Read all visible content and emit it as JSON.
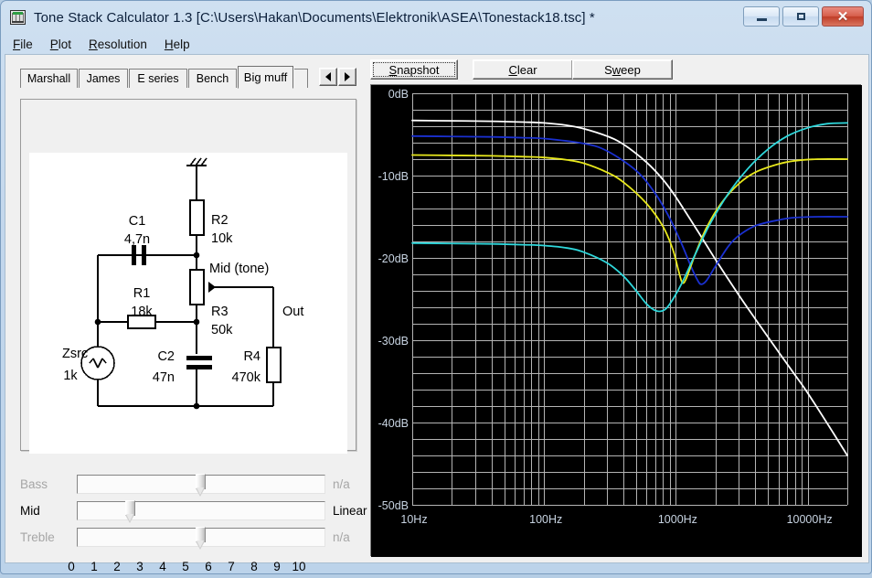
{
  "window": {
    "title": "Tone Stack Calculator 1.3 [C:\\Users\\Hakan\\Documents\\Elektronik\\ASEA\\Tonestack18.tsc] *",
    "icon": "tone-stack-app-icon",
    "buttons": {
      "minimize": "minimize-icon",
      "maximize": "maximize-icon",
      "close": "✕"
    }
  },
  "menubar": {
    "items": [
      {
        "label": "File",
        "accel": "F"
      },
      {
        "label": "Plot",
        "accel": "P"
      },
      {
        "label": "Resolution",
        "accel": "R"
      },
      {
        "label": "Help",
        "accel": "H"
      }
    ]
  },
  "tabs": {
    "items": [
      {
        "label": "Marshall",
        "active": false
      },
      {
        "label": "James",
        "active": false
      },
      {
        "label": "E series",
        "active": false
      },
      {
        "label": "Bench",
        "active": false
      },
      {
        "label": "Big muff",
        "active": true
      }
    ],
    "scroll_prev": "left-arrow-icon",
    "scroll_next": "right-arrow-icon"
  },
  "schematic": {
    "components": [
      {
        "ref": "C1",
        "value": "4,7n"
      },
      {
        "ref": "R2",
        "value": "10k"
      },
      {
        "ref": "R1",
        "value": "18k"
      },
      {
        "ref": "R3",
        "value": "50k"
      },
      {
        "ref": "C2",
        "value": "47n"
      },
      {
        "ref": "R4",
        "value": "470k"
      },
      {
        "ref": "Zsrc",
        "value": "1k"
      }
    ],
    "labels": {
      "mid_tap": "Mid (tone)",
      "output": "Out"
    }
  },
  "sliders": {
    "rows": [
      {
        "name": "bass",
        "label": "Bass",
        "value_text": "n/a",
        "position": 5,
        "disabled": true
      },
      {
        "name": "mid",
        "label": "Mid",
        "value_text": "Linear",
        "position": 1.9,
        "disabled": false
      },
      {
        "name": "treble",
        "label": "Treble",
        "value_text": "n/a",
        "position": 5,
        "disabled": true
      }
    ],
    "scale": [
      "0",
      "1",
      "2",
      "3",
      "4",
      "5",
      "6",
      "7",
      "8",
      "9",
      "10"
    ]
  },
  "toolbar": {
    "snapshot": "Snapshot",
    "clear": "Clear",
    "sweep": "Sweep"
  },
  "chart_data": {
    "type": "line",
    "title": "",
    "xlabel": "",
    "ylabel": "",
    "xscale": "log",
    "xlim": [
      10,
      20000
    ],
    "ylim": [
      -50,
      0
    ],
    "grid": true,
    "legend": false,
    "ytick_labels": [
      "0dB",
      "-10dB",
      "-20dB",
      "-30dB",
      "-40dB",
      "-50dB"
    ],
    "ytick_values": [
      0,
      -10,
      -20,
      -30,
      -40,
      -50
    ],
    "ytick_minor_step": 2,
    "xtick_labels": [
      "10Hz",
      "100Hz",
      "1000Hz",
      "10000Hz"
    ],
    "xtick_values": [
      10,
      100,
      1000,
      10000
    ],
    "background": "#000000",
    "gridcolor": "#b4b4b4",
    "series": [
      {
        "name": "sweep-trace-white",
        "color": "#ffffff",
        "points": [
          [
            10,
            -3.3
          ],
          [
            20,
            -3.35
          ],
          [
            40,
            -3.4
          ],
          [
            70,
            -3.5
          ],
          [
            100,
            -3.6
          ],
          [
            150,
            -3.9
          ],
          [
            200,
            -4.3
          ],
          [
            300,
            -5.2
          ],
          [
            400,
            -6.2
          ],
          [
            600,
            -8.4
          ],
          [
            800,
            -10.5
          ],
          [
            1000,
            -12.6
          ],
          [
            1500,
            -17.0
          ],
          [
            2000,
            -20.2
          ],
          [
            3000,
            -24.5
          ],
          [
            4000,
            -27.4
          ],
          [
            6000,
            -31.4
          ],
          [
            8000,
            -34.2
          ],
          [
            10000,
            -36.4
          ],
          [
            15000,
            -40.8
          ],
          [
            20000,
            -44.0
          ]
        ]
      },
      {
        "name": "sweep-trace-blue",
        "color": "#1a30d0",
        "points": [
          [
            10,
            -5.2
          ],
          [
            20,
            -5.25
          ],
          [
            40,
            -5.3
          ],
          [
            70,
            -5.4
          ],
          [
            100,
            -5.5
          ],
          [
            200,
            -6.1
          ],
          [
            300,
            -7.0
          ],
          [
            500,
            -9.4
          ],
          [
            700,
            -12.2
          ],
          [
            900,
            -15.2
          ],
          [
            1100,
            -18.2
          ],
          [
            1300,
            -21.0
          ],
          [
            1450,
            -22.6
          ],
          [
            1550,
            -23.2
          ],
          [
            1700,
            -22.8
          ],
          [
            2000,
            -21.0
          ],
          [
            2500,
            -18.6
          ],
          [
            3000,
            -17.3
          ],
          [
            4000,
            -16.1
          ],
          [
            6000,
            -15.4
          ],
          [
            8000,
            -15.1
          ],
          [
            12000,
            -15.0
          ],
          [
            20000,
            -15.0
          ]
        ]
      },
      {
        "name": "sweep-trace-yellow",
        "color": "#e8e81c",
        "points": [
          [
            10,
            -7.5
          ],
          [
            20,
            -7.55
          ],
          [
            40,
            -7.6
          ],
          [
            70,
            -7.7
          ],
          [
            100,
            -7.8
          ],
          [
            150,
            -8.1
          ],
          [
            200,
            -8.5
          ],
          [
            300,
            -9.6
          ],
          [
            400,
            -10.8
          ],
          [
            600,
            -13.4
          ],
          [
            800,
            -16.2
          ],
          [
            950,
            -19.0
          ],
          [
            1050,
            -21.6
          ],
          [
            1120,
            -23.0
          ],
          [
            1200,
            -22.5
          ],
          [
            1400,
            -19.6
          ],
          [
            1700,
            -16.4
          ],
          [
            2200,
            -13.4
          ],
          [
            3000,
            -11.0
          ],
          [
            4000,
            -9.6
          ],
          [
            6000,
            -8.6
          ],
          [
            8000,
            -8.2
          ],
          [
            12000,
            -8.0
          ],
          [
            20000,
            -8.0
          ]
        ]
      },
      {
        "name": "sweep-trace-cyan",
        "color": "#2fd8dc",
        "points": [
          [
            10,
            -18.2
          ],
          [
            20,
            -18.25
          ],
          [
            40,
            -18.3
          ],
          [
            70,
            -18.4
          ],
          [
            100,
            -18.5
          ],
          [
            150,
            -18.8
          ],
          [
            200,
            -19.3
          ],
          [
            300,
            -20.6
          ],
          [
            400,
            -22.2
          ],
          [
            500,
            -24.0
          ],
          [
            600,
            -25.6
          ],
          [
            700,
            -26.4
          ],
          [
            800,
            -26.4
          ],
          [
            900,
            -25.6
          ],
          [
            1100,
            -23.2
          ],
          [
            1400,
            -19.6
          ],
          [
            1800,
            -16.0
          ],
          [
            2500,
            -12.2
          ],
          [
            3500,
            -9.2
          ],
          [
            5000,
            -6.8
          ],
          [
            7000,
            -5.2
          ],
          [
            10000,
            -4.2
          ],
          [
            14000,
            -3.7
          ],
          [
            20000,
            -3.6
          ]
        ]
      }
    ]
  }
}
